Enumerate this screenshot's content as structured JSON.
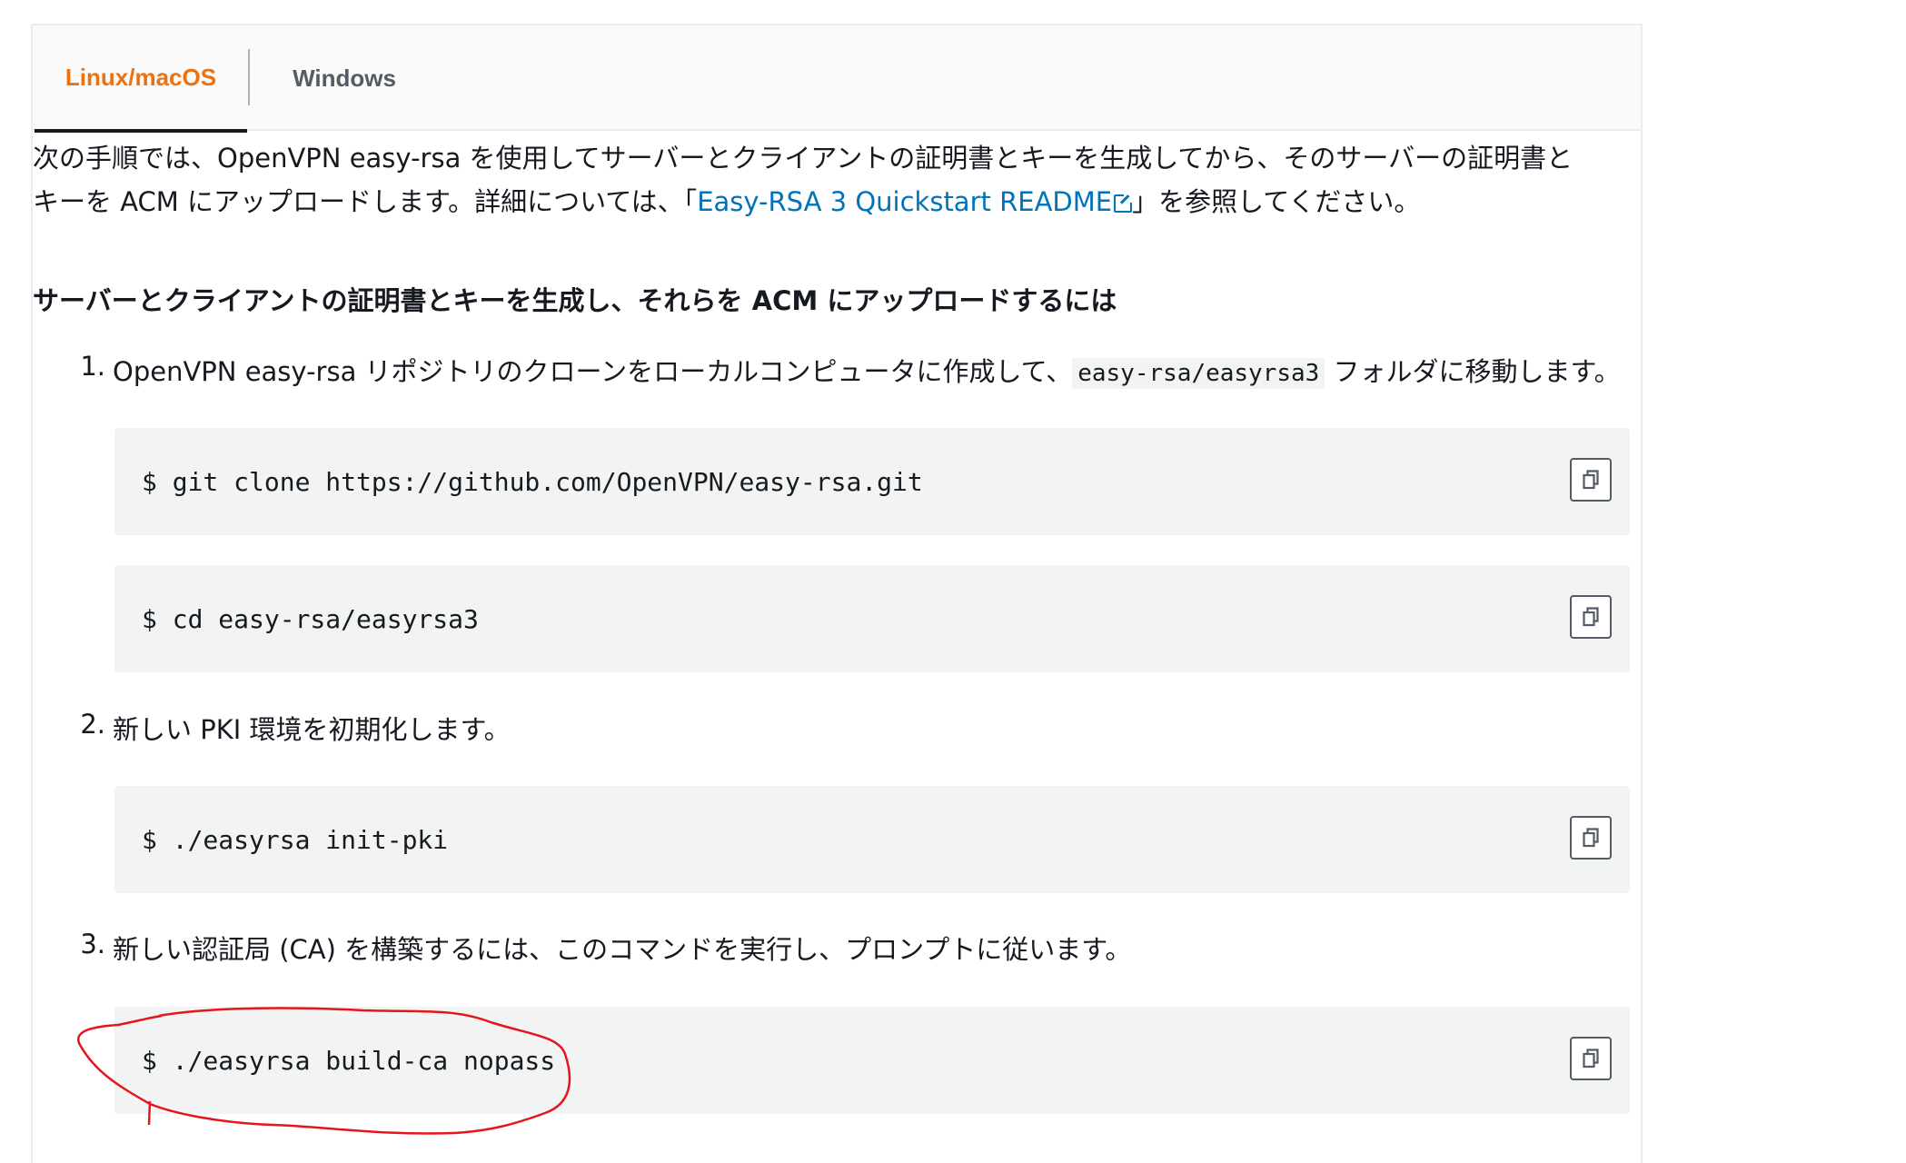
{
  "tabs": [
    {
      "label": "Linux/macOS",
      "active": true
    },
    {
      "label": "Windows",
      "active": false
    }
  ],
  "intro": {
    "before_link": "次の手順では、OpenVPN easy-rsa を使用してサーバーとクライアントの証明書とキーを生成してから、そのサーバーの証明書とキーを ACM にアップロードします。詳細については、「",
    "link_text": "Easy-RSA 3 Quickstart README",
    "after_link": "」を参照してください。"
  },
  "heading": "サーバーとクライアントの証明書とキーを生成し、それらを ACM にアップロードするには",
  "steps": [
    {
      "number": "1.",
      "text_before": "OpenVPN easy-rsa リポジトリのクローンをローカルコンピュータに作成して、",
      "code": "easy-rsa/easyrsa3",
      "text_after": " フォルダに移動します。"
    },
    {
      "number": "2.",
      "text": "新しい PKI 環境を初期化します。"
    },
    {
      "number": "3.",
      "text": "新しい認証局 (CA) を構築するには、このコマンドを実行し、プロンプトに従います。"
    }
  ],
  "code_blocks": [
    "$ git clone https://github.com/OpenVPN/easy-rsa.git",
    "$ cd easy-rsa/easyrsa3",
    "$ ./easyrsa init-pki",
    "$ ./easyrsa build-ca nopass"
  ],
  "colors": {
    "active_tab": "#ec7211",
    "link": "#0073bb",
    "annotation": "#e8141b",
    "code_bg": "#f2f3f3"
  },
  "icons": {
    "copy": "copy-icon",
    "external_link": "external-link-icon"
  }
}
